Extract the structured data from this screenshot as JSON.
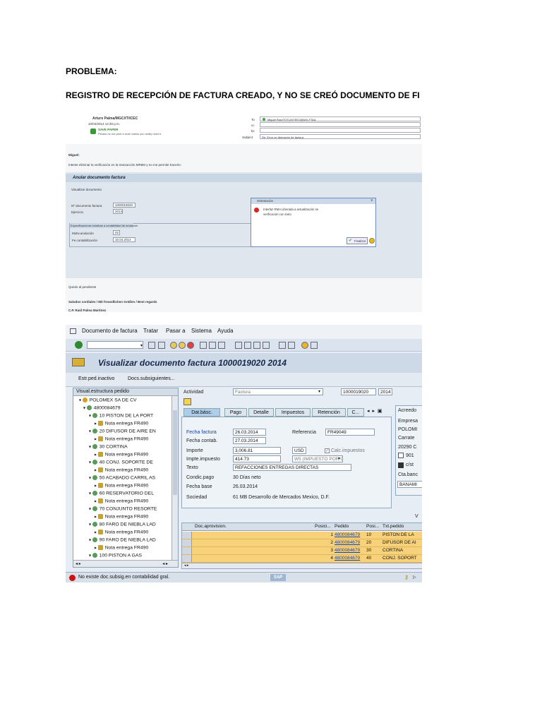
{
  "doc": {
    "heading1": "PROBLEMA:",
    "heading2": "REGISTRO DE RECEPCIÓN DE FACTURA CREADO, Y NO SE CREÓ DOCUMENTO DE FI"
  },
  "email": {
    "sender": "Arturo Palma/MGCXT/ICEC",
    "date": "10/04/2014 12:30 p.m.",
    "save_paper": "SAVE PAPER",
    "save_paper_sub": "Please do not print e-mail unless you really need it",
    "to_label": "To",
    "cc_label": "cc",
    "bcc_label": "bc",
    "subject_label": "Subject",
    "to_value": "Miguel Ruiz/TOTLINTEEO@MX-FTAA",
    "subject_value": "Re: Error en liberación de factura",
    "greeting": "Miguel:",
    "body": "Intente eliminar la verificación en la transacción MR8M y no me permite hacerlo:",
    "sap_title": "Anular documento factura",
    "sap_action": "Visualizar documento",
    "doc_num_label": "Nº documento factura",
    "doc_num_value": "1000019020",
    "year_label": "Ejercicio",
    "year_value": "2014",
    "spec_title": "Especificaciones relativas a contabilidad de anulación",
    "reason_label": "Motiv.anulación",
    "reason_value": "02",
    "postdate_label": "Fe.contabilización",
    "postdate_value": "10.04.2014",
    "dialog_title": "Orientación",
    "dialog_msg1": "Interfaz RMA Liberada a actualización se",
    "dialog_msg2": "verificación con éxito",
    "dialog_btn": "Finalizar",
    "closing": "Quedo al pendiente",
    "regards": "Saludos cordiales / Mit freundlichen Grüßen / Best regards",
    "signature": "C.P. Raúl Palma Martínez"
  },
  "sap": {
    "menu": [
      "Documento de factura",
      "Tratar",
      "Pasar a",
      "Sistema",
      "Ayuda"
    ],
    "title": "Visualizar documento factura 1000019020 2014",
    "app_toolbar": [
      "Estr.ped.inactivo",
      "Docs.subsiguientes..."
    ],
    "tree_header": "Visual.estructura pedido",
    "tree": [
      {
        "indent": 0,
        "text": "POLOMEX SA DE CV"
      },
      {
        "indent": 1,
        "text": "4800084679"
      },
      {
        "indent": 2,
        "text": "10 PISTON DE LA PORT"
      },
      {
        "indent": 3,
        "text": "Nota entrega FR490"
      },
      {
        "indent": 2,
        "text": "20 DIFUSOR DE AIRE EN"
      },
      {
        "indent": 3,
        "text": "Nota entrega FR490"
      },
      {
        "indent": 2,
        "text": "30 CORTINA"
      },
      {
        "indent": 3,
        "text": "Nota entrega FR490"
      },
      {
        "indent": 2,
        "text": "40 CONJ. SOPORTE DE"
      },
      {
        "indent": 3,
        "text": "Nota entrega FR490"
      },
      {
        "indent": 2,
        "text": "50 ACABADO CARRIL AS"
      },
      {
        "indent": 3,
        "text": "Nota entrega FR490"
      },
      {
        "indent": 2,
        "text": "60 RESERVATORIO DEL"
      },
      {
        "indent": 3,
        "text": "Nota entrega FR490"
      },
      {
        "indent": 2,
        "text": "70 CONJUNTO RESORTE"
      },
      {
        "indent": 3,
        "text": "Nota entrega FR490"
      },
      {
        "indent": 2,
        "text": "80 FARO DE NIEBLA LAD"
      },
      {
        "indent": 3,
        "text": "Nota entrega FR490"
      },
      {
        "indent": 2,
        "text": "90 FARO DE NIEBLA LAD"
      },
      {
        "indent": 3,
        "text": "Nota entrega FR490"
      },
      {
        "indent": 2,
        "text": "100 PISTON A GAS"
      }
    ],
    "activity_label": "Actividad",
    "activity_value": "Factura",
    "doc_number": "1000019020",
    "doc_year": "2014",
    "tabs": [
      "Dat.básc.",
      "Pago",
      "Detalle",
      "Impuestos",
      "Retención",
      "C..."
    ],
    "fields": {
      "fecha_factura_label": "Fecha factura",
      "fecha_factura": "26.03.2014",
      "referencia_label": "Referencia",
      "referencia": "FR49049",
      "fecha_contab_label": "Fecha contab.",
      "fecha_contab": "27.03.2014",
      "importe_label": "Importe",
      "importe": "3,006.81",
      "moneda": "USD",
      "calc_impuestos": "Calc.impuestos",
      "impte_impuesto_label": "Impte.impuesto",
      "impte_impuesto": "414.73",
      "impuesto_code": "W5 (IMPUESTO POR C...",
      "texto_label": "Texto",
      "texto": "REFACCIONES ENTREGAS DIRECTAS",
      "condic_pago_label": "Condic.pago",
      "condic_pago": "30 Días neto",
      "fecha_base_label": "Fecha base",
      "fecha_base": "26.03.2014",
      "sociedad_label": "Sociedad",
      "sociedad": "61 MB Desarrollo de Mercados Mexico, D.F."
    },
    "vendor_panel": {
      "title": "Acreedo",
      "line1": "Empresa",
      "line2": "POLOMI",
      "line3": "Carrate",
      "line4": "20290 C",
      "line5": "901",
      "line6": "c/st",
      "line7": "Cta.banc",
      "line8": "BANAMI"
    },
    "grid": {
      "headers": [
        "Doc.aprovision.",
        "Posici...",
        "Pedido",
        "Posi...",
        "Txt.pedido"
      ],
      "rows": [
        {
          "pos": "1",
          "pedido": "4800084679",
          "posi": "10",
          "txt": "PISTON DE LA"
        },
        {
          "pos": "2",
          "pedido": "4800084679",
          "posi": "20",
          "txt": "DIFUSOR DE AI"
        },
        {
          "pos": "3",
          "pedido": "4800084679",
          "posi": "30",
          "txt": "CORTINA"
        },
        {
          "pos": "4",
          "pedido": "4800084679",
          "posi": "40",
          "txt": "CONJ. SOPORT"
        }
      ]
    },
    "status_msg": "No existe doc.subsig.en contabilidad gral.",
    "sap_logo": "SAP",
    "v_label": "V"
  },
  "colors": {
    "sap_bg": "#e6edf4",
    "sap_title_bar": "#cdd9e6",
    "grid_yellow": "#f7d27a",
    "link_blue": "#1a3f9a",
    "error_red": "#cc1111"
  }
}
